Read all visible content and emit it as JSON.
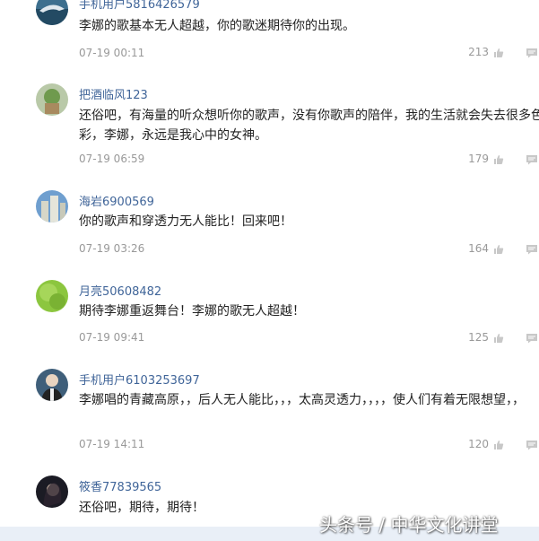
{
  "comments": [
    {
      "username": "手机用户5816426579",
      "text": "李娜的歌基本无人超越，你的歌迷期待你的出现。",
      "time": "07-19 00:11",
      "likes": "213",
      "avatar_icon": "shark-photo-avatar"
    },
    {
      "username": "把酒临风123",
      "text": "还俗吧，有海量的听众想听你的歌声，没有你歌声的陪伴，我的生活就会失去很多色彩，李娜，永远是我心中的女神。",
      "time": "07-19 06:59",
      "likes": "179",
      "avatar_icon": "green-cartoon-avatar"
    },
    {
      "username": "海岩6900569",
      "text": "你的歌声和穿透力无人能比！回来吧！",
      "time": "07-19 03:26",
      "likes": "164",
      "avatar_icon": "buildings-photo-avatar"
    },
    {
      "username": "月亮50608482",
      "text": "期待李娜重返舞台！李娜的歌无人超越！",
      "time": "07-19 09:41",
      "likes": "125",
      "avatar_icon": "green-leaf-avatar"
    },
    {
      "username": "手机用户6103253697",
      "text": "李娜唱的青藏高原，，后人无人能比，，，太高灵透力，，，，使人们有着无限想望，，",
      "time": "07-19 14:11",
      "likes": "120",
      "avatar_icon": "person-photo-avatar"
    },
    {
      "username": "筱香77839565",
      "text": "还俗吧，期待，期待！",
      "time": "",
      "likes": "",
      "avatar_icon": "dark-portrait-avatar"
    }
  ],
  "watermark": "头条号 / 中华文化讲堂",
  "colors": {
    "username": "#406599",
    "meta": "#999999",
    "text": "#222222"
  }
}
